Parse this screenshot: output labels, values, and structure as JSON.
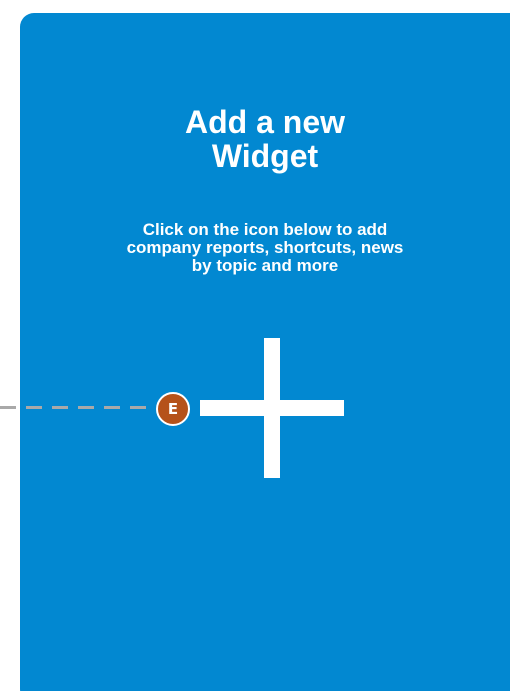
{
  "colors": {
    "card_background": "#0288d1",
    "badge_background": "#b5521a",
    "callout_line": "#a9a9a9",
    "text": "#ffffff"
  },
  "widget": {
    "title_line1": "Add a new",
    "title_line2": "Widget",
    "description_line1": "Click on the icon below to add",
    "description_line2": "company reports, shortcuts, news",
    "description_line3": "by topic and more",
    "add_icon": "plus-icon"
  },
  "callout": {
    "label": "E"
  }
}
